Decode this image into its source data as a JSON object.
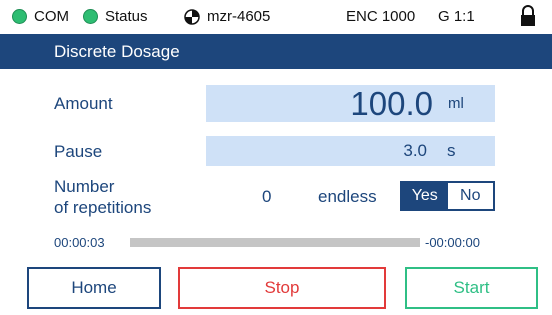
{
  "status_bar": {
    "com_label": "COM",
    "status_label": "Status",
    "device": "mzr-4605",
    "encoder": "ENC 1000",
    "gear": "G 1:1",
    "led_color": "#2ebd72"
  },
  "screen": {
    "title": "Discrete Dosage"
  },
  "amount": {
    "label": "Amount",
    "value": "100.0",
    "unit": "ml"
  },
  "pause": {
    "label": "Pause",
    "value": "3.0",
    "unit": "s"
  },
  "repetitions": {
    "label_line1": "Number",
    "label_line2": "of repetitions",
    "value": "0",
    "endless_label": "endless",
    "yes_label": "Yes",
    "no_label": "No",
    "selected": "Yes"
  },
  "progress": {
    "elapsed": "00:00:03",
    "remaining": "-00:00:00",
    "fraction": 0.0
  },
  "buttons": {
    "home": "Home",
    "stop": "Stop",
    "start": "Start"
  },
  "colors": {
    "accent": "#1d467c",
    "field": "#cfe1f7",
    "stop": "#e23a3a",
    "start": "#2fbf85"
  }
}
